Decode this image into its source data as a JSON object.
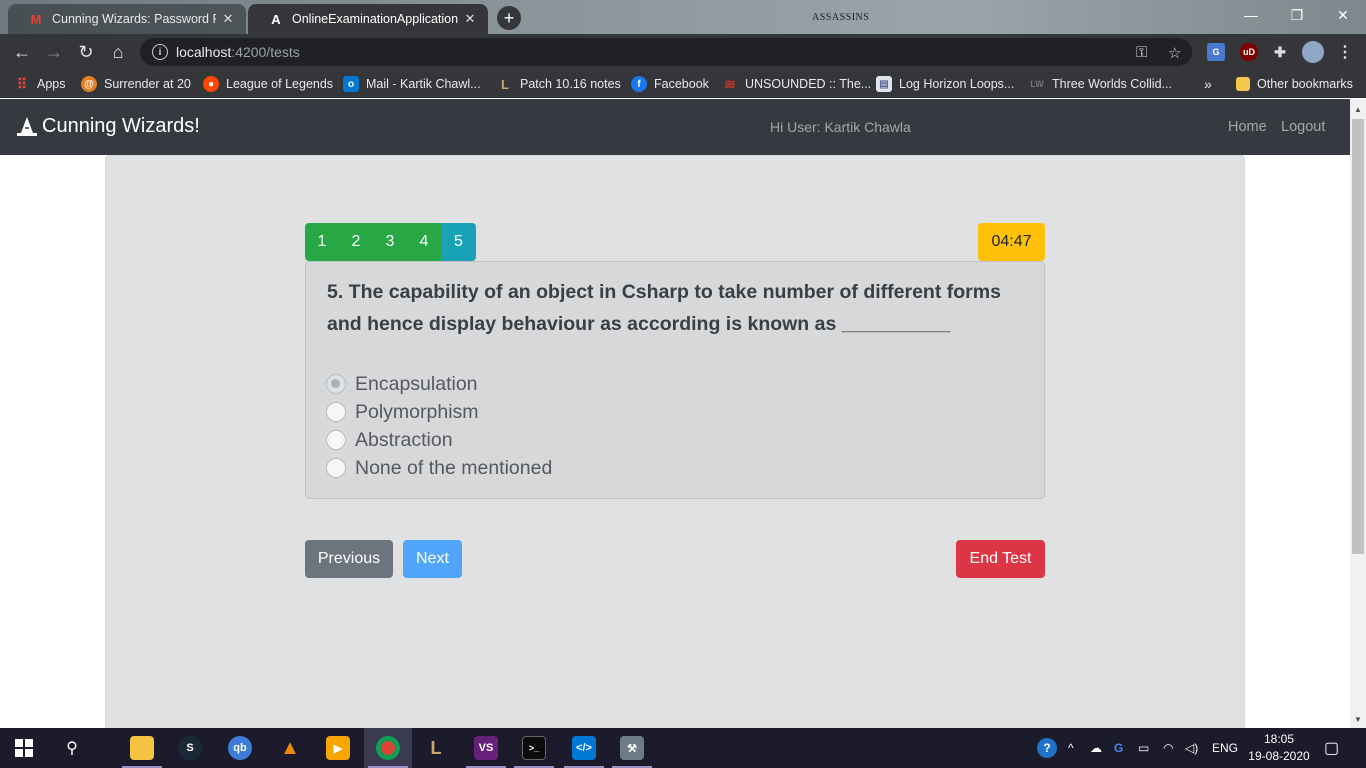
{
  "browser": {
    "tabs": [
      {
        "title": "Cunning Wizards: Password Rese",
        "icon": "gmail-icon",
        "active": false
      },
      {
        "title": "OnlineExaminationApplication",
        "icon": "angular-icon",
        "active": true
      }
    ],
    "theme_brand_text": "ASSASSINS",
    "url_host": "localhost",
    "url_path": ":4200/tests",
    "bookmarks": [
      {
        "label": "Apps",
        "icon": "apps-grid-icon",
        "color": "#e8453c"
      },
      {
        "label": "Surrender at 20",
        "icon": "surrender-icon",
        "color": "#e67e22"
      },
      {
        "label": "League of Legends",
        "icon": "reddit-icon",
        "color": "#ff4500"
      },
      {
        "label": "Mail - Kartik Chawl...",
        "icon": "outlook-icon",
        "color": "#0078d4"
      },
      {
        "label": "Patch 10.16 notes",
        "icon": "league-icon",
        "color": "#c8aa6e"
      },
      {
        "label": "Facebook",
        "icon": "facebook-icon",
        "color": "#1877f2"
      },
      {
        "label": "UNSOUNDED :: The...",
        "icon": "unsounded-icon",
        "color": "#c0392b"
      },
      {
        "label": "Log Horizon Loops...",
        "icon": "page-icon",
        "color": "#5b6a9a"
      },
      {
        "label": "Three Worlds Collid...",
        "icon": "lw-icon",
        "color": "#444"
      }
    ],
    "bookmarks_overflow": "»",
    "other_bookmarks": "Other bookmarks"
  },
  "app": {
    "brand": "Cunning Wizards!",
    "greeting": "Hi User: Kartik Chawla",
    "nav": [
      "Home",
      "Logout"
    ]
  },
  "exam": {
    "question_numbers": [
      "1",
      "2",
      "3",
      "4",
      "5"
    ],
    "current_question": "5",
    "timer": "04:47",
    "question_text": "5. The capability of an object in Csharp to take number of different forms and hence display behaviour as according is known as __________",
    "options": [
      {
        "label": "Encapsulation",
        "selected": true
      },
      {
        "label": "Polymorphism",
        "selected": false
      },
      {
        "label": "Abstraction",
        "selected": false
      },
      {
        "label": "None of the mentioned",
        "selected": false
      }
    ],
    "buttons": {
      "previous": "Previous",
      "next": "Next",
      "end": "End Test"
    }
  },
  "taskbar": {
    "language": "ENG",
    "time": "18:05",
    "date": "19-08-2020"
  },
  "colors": {
    "answered": "#28a745",
    "current": "#17a2b8",
    "timer": "#ffc107",
    "danger": "#dc3545",
    "primary": "#51a6fb",
    "secondary": "#6c757d",
    "navbar": "#343a40"
  }
}
